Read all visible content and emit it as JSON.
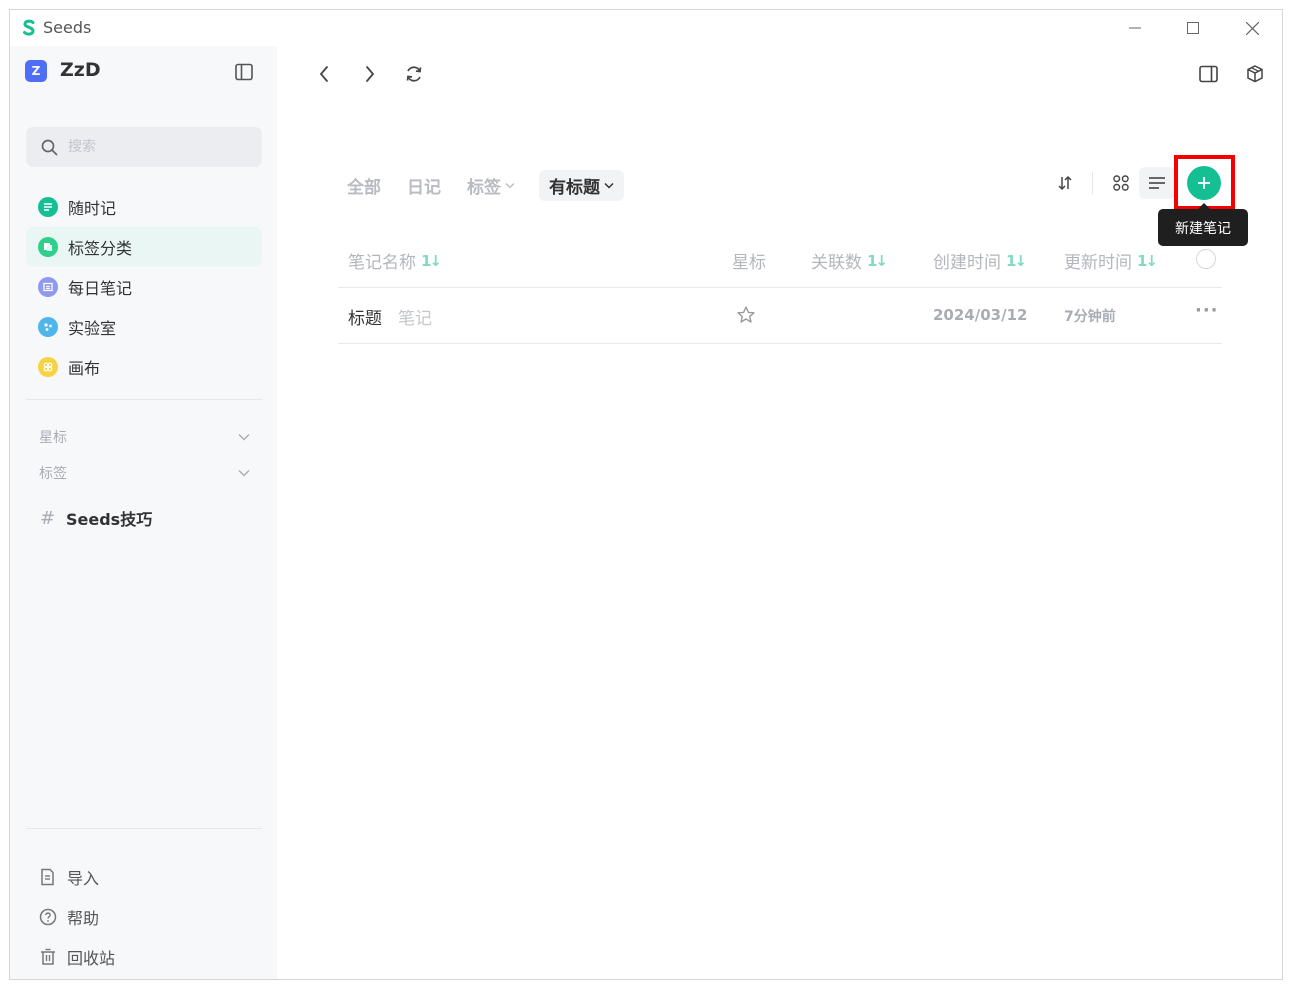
{
  "window": {
    "title": "Seeds"
  },
  "workspace": {
    "badge": "Z",
    "name": "ZzD"
  },
  "search": {
    "placeholder": "搜索"
  },
  "nav": {
    "items": [
      {
        "label": "随时记",
        "color": "#14bf94"
      },
      {
        "label": "标签分类",
        "color": "#2fd08c"
      },
      {
        "label": "每日笔记",
        "color": "#8e9af0"
      },
      {
        "label": "实验室",
        "color": "#4fb6ec"
      },
      {
        "label": "画布",
        "color": "#f7d343"
      }
    ]
  },
  "sections": {
    "starred": "星标",
    "tags": "标签"
  },
  "tags": [
    {
      "hash": "#",
      "label": "Seeds技巧"
    }
  ],
  "bottom_nav": {
    "import": "导入",
    "help": "帮助",
    "trash": "回收站"
  },
  "filters": {
    "all": "全部",
    "diary": "日记",
    "tags": "标签",
    "titled": "有标题"
  },
  "tooltip": {
    "new_note": "新建笔记"
  },
  "table": {
    "headers": {
      "name": "笔记名称",
      "star": "星标",
      "links": "关联数",
      "created": "创建时间",
      "updated": "更新时间",
      "sort_glyph": "1↓"
    },
    "rows": [
      {
        "title": "标题",
        "subtitle": "笔记",
        "created": "2024/03/12",
        "updated": "7分钟前",
        "more": "···"
      }
    ]
  },
  "colors": {
    "accent": "#14bf94",
    "highlight": "#f40000"
  }
}
